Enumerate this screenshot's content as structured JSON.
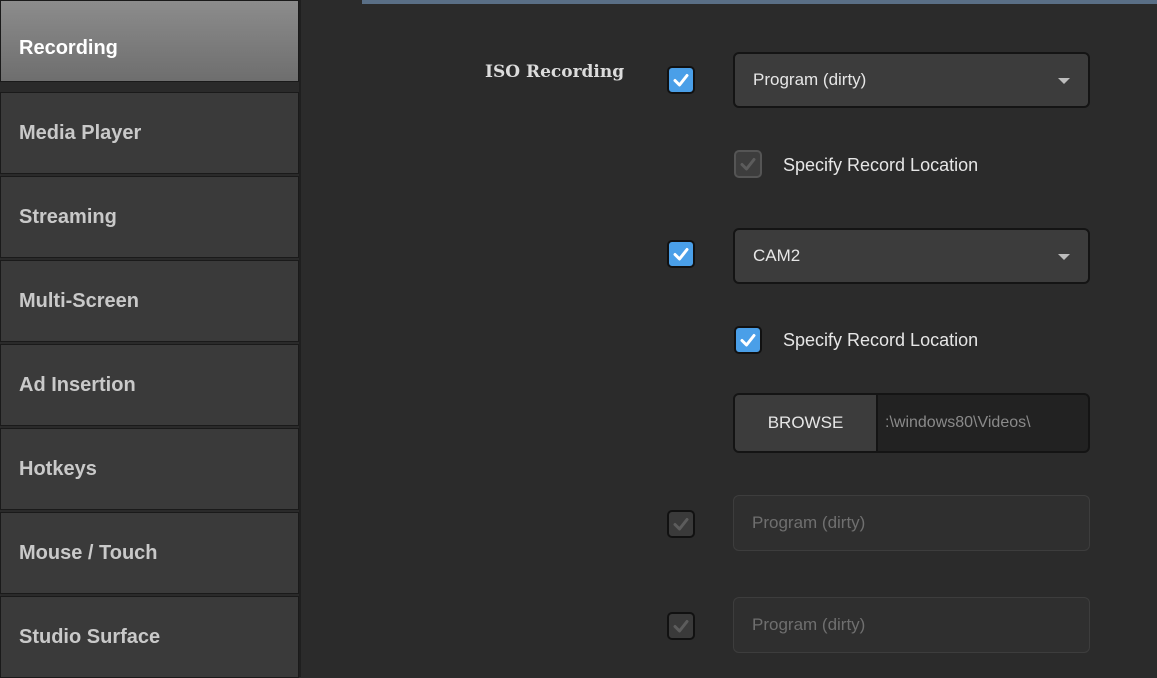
{
  "sidebar": {
    "items": [
      {
        "label": "Recording",
        "active": true
      },
      {
        "label": "Media Player"
      },
      {
        "label": "Streaming"
      },
      {
        "label": "Multi-Screen"
      },
      {
        "label": "Ad Insertion"
      },
      {
        "label": "Hotkeys"
      },
      {
        "label": "Mouse / Touch"
      },
      {
        "label": "Studio Surface"
      }
    ]
  },
  "iso": {
    "label": "ISO Recording",
    "rows": [
      {
        "checked": true,
        "source": "Program (dirty)",
        "specify_label": "Specify Record Location",
        "specify_checked": true,
        "specify_disabled": true
      },
      {
        "checked": true,
        "source": "CAM2",
        "specify_label": "Specify Record Location",
        "specify_checked": true,
        "browse_label": "BROWSE",
        "path": ":\\windows80\\Videos\\"
      },
      {
        "checked": true,
        "disabled": true,
        "source": "Program (dirty)"
      },
      {
        "checked": true,
        "disabled": true,
        "source": "Program (dirty)"
      }
    ]
  },
  "colors": {
    "accent": "#4a9fe8",
    "sidebar_active": "#7d7d7d",
    "background": "#2b2b2b"
  }
}
